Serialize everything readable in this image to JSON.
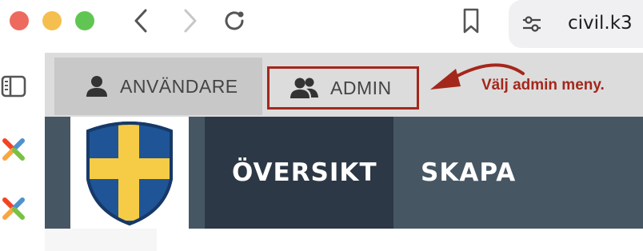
{
  "browser": {
    "address_text": "civil.k3",
    "icons": [
      "back-icon",
      "forward-icon",
      "reload-icon",
      "bookmark-icon",
      "site-settings-icon"
    ]
  },
  "sidebar": {
    "icons": [
      "sidebar-toggle-icon",
      "joomla-icon",
      "joomla-icon"
    ]
  },
  "admin_menu": {
    "users_label": "ANVÄNDARE",
    "admin_label": "ADMIN",
    "hint": "Välj admin meny."
  },
  "site_nav": {
    "overview_label": "ÖVERSIKT",
    "create_label": "SKAPA"
  },
  "colors": {
    "highlight": "#a4271b",
    "header_bg": "#475663",
    "active_nav_bg": "#2c3845",
    "shield_blue": "#1f5596",
    "shield_cross": "#f6cb45"
  }
}
